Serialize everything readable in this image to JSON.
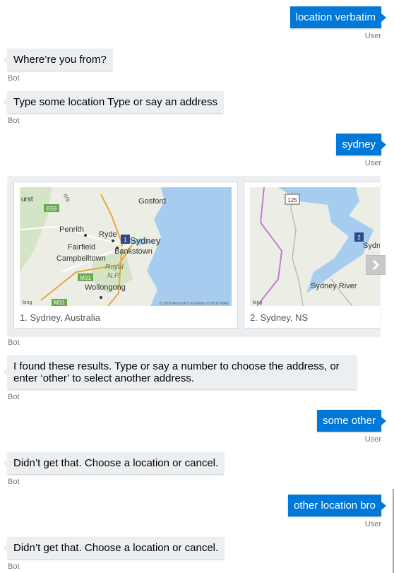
{
  "messages": [
    {
      "from": "user",
      "text": "location verbatim",
      "sender_label": "User"
    },
    {
      "from": "bot",
      "text": "Where’re you from?",
      "sender_label": "Bot"
    },
    {
      "from": "bot",
      "text": "Type some location Type or say an address",
      "sender_label": "Bot"
    },
    {
      "from": "user",
      "text": "sydney",
      "sender_label": "User"
    },
    {
      "from": "bot",
      "sender_label": "Bot"
    },
    {
      "from": "bot",
      "text": "I found these results. Type or say a number to choose the address, or enter ‘other’ to select another address.",
      "sender_label": "Bot"
    },
    {
      "from": "user",
      "text": "some other",
      "sender_label": "User"
    },
    {
      "from": "bot",
      "text": "Didn’t get that. Choose a location or cancel.",
      "sender_label": "Bot"
    },
    {
      "from": "user",
      "text": "other location bro",
      "sender_label": "User"
    },
    {
      "from": "bot",
      "text": "Didn’t get that. Choose a location or cancel.",
      "sender_label": "Bot"
    }
  ],
  "carousel": {
    "cards": [
      {
        "title": "1. Sydney, Australia",
        "map": {
          "pin_number": "1",
          "labels": [
            "urst",
            "B59",
            "Penrith",
            "Gosford",
            "Ryde",
            "Sydney",
            "Fairfield",
            "Bankstown",
            "Campbelltown",
            "Royal",
            "N.P.",
            "M31",
            "Wollongong",
            "M31",
            "ark"
          ],
          "copyright": "© 2018 Microsoft Corporation © 2018 HERE",
          "brand": "bing"
        }
      },
      {
        "title": "2. Sydney, NS",
        "map": {
          "pin_number": "2",
          "labels": [
            "125",
            "Sydney",
            "Sydney River"
          ],
          "brand": "bing"
        }
      }
    ],
    "next_icon": "chevron-right-icon"
  },
  "colors": {
    "user_bubble": "#0078d7",
    "bot_bubble": "#eceff1",
    "sender_label": "#767676"
  }
}
